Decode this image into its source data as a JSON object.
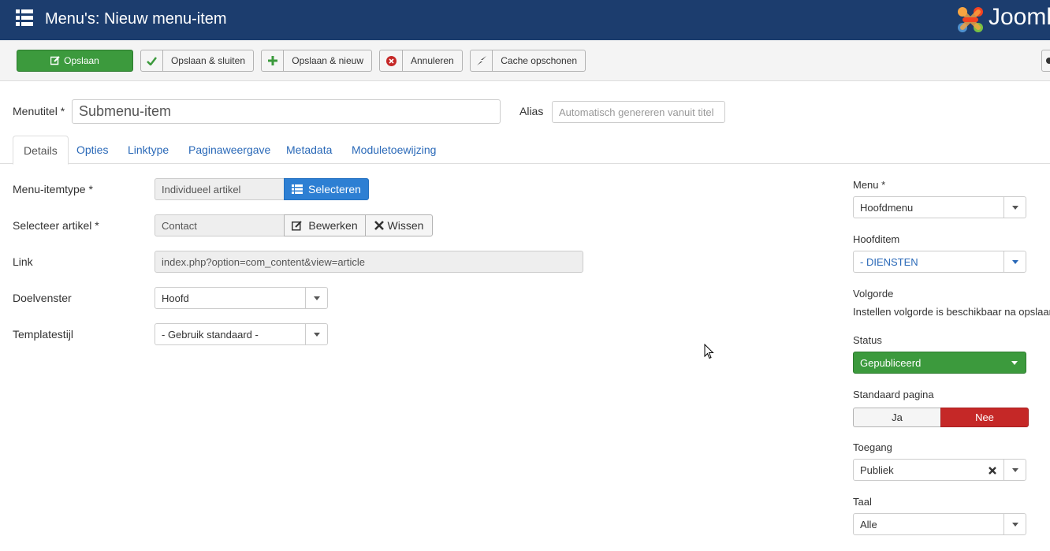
{
  "header": {
    "title": "Menu's: Nieuw menu-item",
    "brand": "Joomla!",
    "icons": {
      "menu": "menu-grid-icon",
      "logo": "joomla-logo-icon"
    }
  },
  "toolbar": {
    "save": "Opslaan",
    "save_close": "Opslaan & sluiten",
    "save_new": "Opslaan & nieuw",
    "cancel": "Annuleren",
    "clear_cache": "Cache opschonen",
    "colors": {
      "save": "#3c9a3d",
      "cancel_icon": "#c52827"
    }
  },
  "title_row": {
    "title_label": "Menutitel *",
    "title_value": "Submenu-item",
    "alias_label": "Alias",
    "alias_placeholder": "Automatisch genereren vanuit titel"
  },
  "tabs": [
    "Details",
    "Opties",
    "Linktype",
    "Paginaweergave",
    "Metadata",
    "Moduletoewijzing"
  ],
  "details": {
    "menu_item_type": {
      "label": "Menu-itemtype *",
      "value": "Individueel artikel",
      "button": "Selecteren"
    },
    "select_article": {
      "label": "Selecteer artikel *",
      "value": "Contact",
      "edit": "Bewerken",
      "clear": "Wissen"
    },
    "link": {
      "label": "Link",
      "value": "index.php?option=com_content&view=article"
    },
    "target_window": {
      "label": "Doelvenster",
      "value": "Hoofd"
    },
    "template_style": {
      "label": "Templatestijl",
      "value": "- Gebruik standaard -"
    }
  },
  "sidebar": {
    "menu": {
      "label": "Menu *",
      "value": "Hoofdmenu"
    },
    "parent": {
      "label": "Hoofditem",
      "value": "- DIENSTEN"
    },
    "ordering": {
      "label": "Volgorde",
      "note": "Instellen volgorde is beschikbaar na opslaan."
    },
    "status": {
      "label": "Status",
      "value": "Gepubliceerd"
    },
    "default_page": {
      "label": "Standaard pagina",
      "yes": "Ja",
      "no": "Nee"
    },
    "access": {
      "label": "Toegang",
      "value": "Publiek"
    },
    "language": {
      "label": "Taal",
      "value": "Alle"
    },
    "colors": {
      "status": "#3c9a3d",
      "no_active": "#c52827",
      "parent_text": "#2a69b8"
    }
  }
}
